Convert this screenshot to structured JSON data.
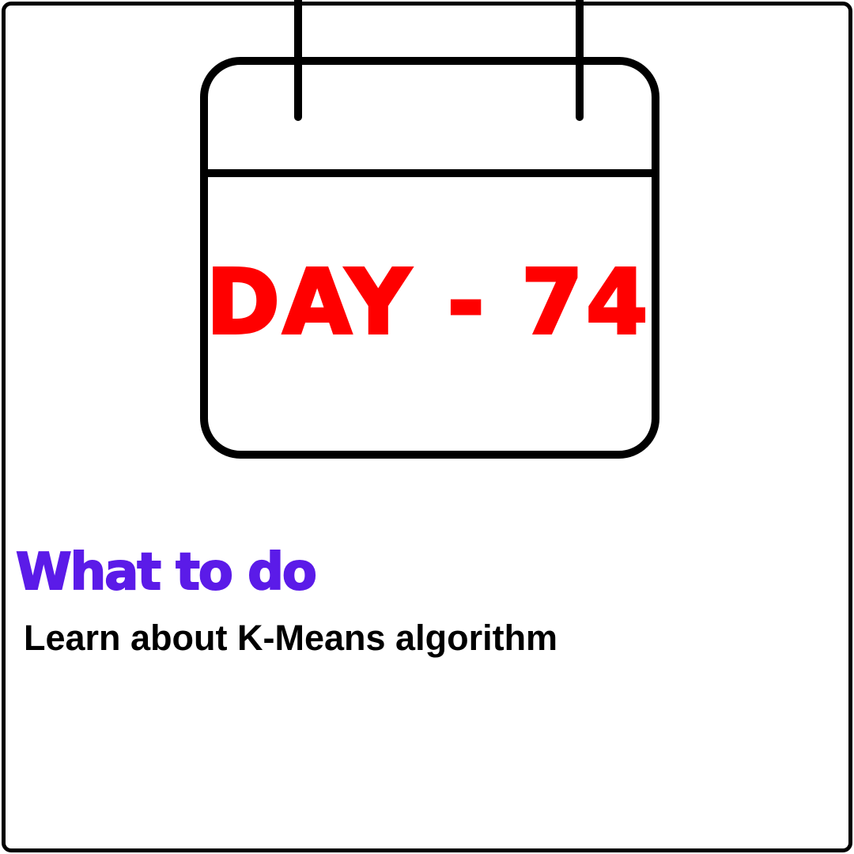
{
  "calendar": {
    "day_text": "DAY - 74",
    "icon": "calendar-icon"
  },
  "todo": {
    "heading": "What to do",
    "task": "Learn about K-Means algorithm"
  },
  "colors": {
    "day_text": "#ff0000",
    "heading": "#5b1be8",
    "outline": "#000000",
    "background": "#ffffff"
  }
}
